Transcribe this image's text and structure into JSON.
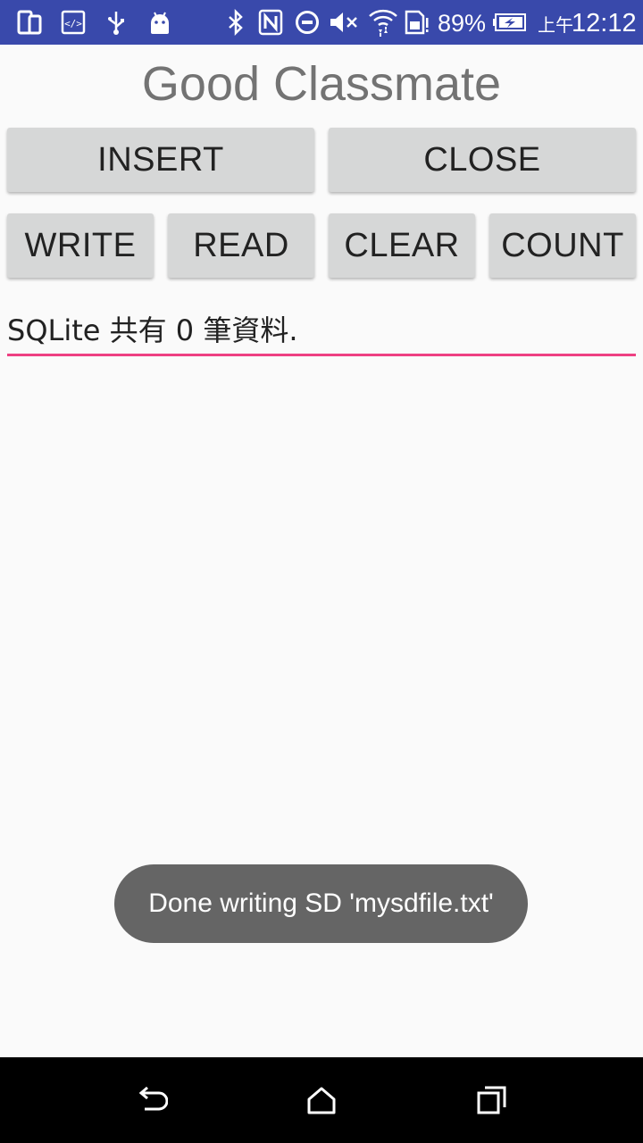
{
  "status_bar": {
    "battery_percent": "89%",
    "time_period": "上午",
    "time": "12:12",
    "icons": [
      "screen-mirror-icon",
      "code-icon",
      "usb-icon",
      "android-icon",
      "bluetooth-icon",
      "nfc-icon",
      "do-not-disturb-icon",
      "mute-icon",
      "wifi-icon",
      "sim-alert-icon",
      "battery-charging-icon"
    ],
    "background_color": "#3949ab"
  },
  "app": {
    "title": "Good Classmate"
  },
  "buttons": {
    "insert": "INSERT",
    "close": "CLOSE",
    "write": "WRITE",
    "read": "READ",
    "clear": "CLEAR",
    "count": "COUNT"
  },
  "edit_text": {
    "value": "SQLite 共有 0 筆資料.",
    "underline_color": "#ee4082"
  },
  "toast": {
    "message": "Done writing SD 'mysdfile.txt'"
  },
  "nav_bar": {
    "icons": [
      "back-icon",
      "home-icon",
      "recents-icon"
    ]
  }
}
